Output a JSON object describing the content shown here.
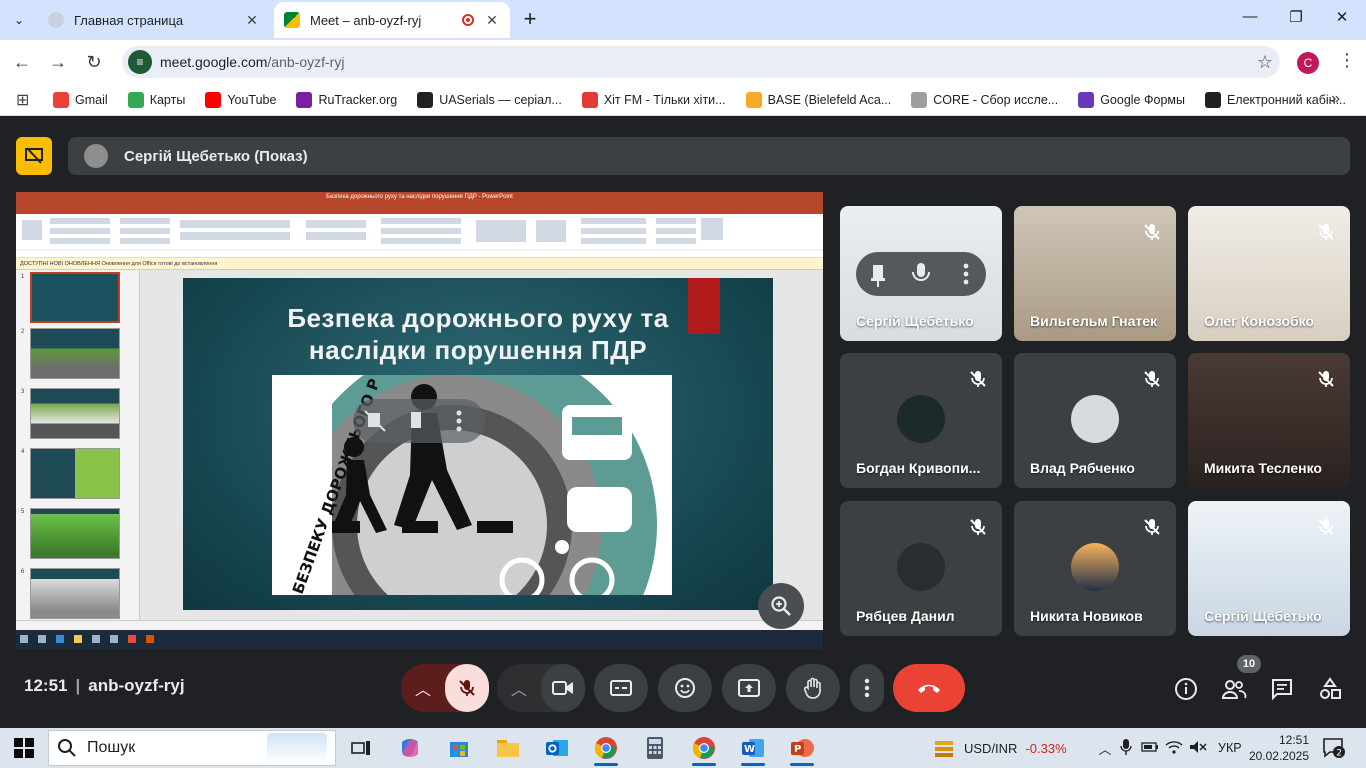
{
  "browser": {
    "tabs": [
      {
        "title": "Главная страница"
      },
      {
        "title": "Meet – anb-oyzf-ryj"
      }
    ],
    "url_host": "meet.google.com",
    "url_path": "/anb-oyzf-ryj",
    "profile_initial": "C",
    "bookmarks": [
      {
        "label": "Gmail",
        "color": "#ea4335"
      },
      {
        "label": "Карты",
        "color": "#34a853"
      },
      {
        "label": "YouTube",
        "color": "#ff0000"
      },
      {
        "label": "RuTracker.org",
        "color": "#7b1fa2"
      },
      {
        "label": "UASerials — серіал...",
        "color": "#222222"
      },
      {
        "label": "Хіт FM - Тільки хіти...",
        "color": "#e53935"
      },
      {
        "label": "BASE (Bielefeld Aca...",
        "color": "#f9a825"
      },
      {
        "label": "CORE - Сбор иссле...",
        "color": "#9e9e9e"
      },
      {
        "label": "Google Формы",
        "color": "#673ab7"
      },
      {
        "label": "Електронний кабін...",
        "color": "#1f1f1f"
      }
    ]
  },
  "meet": {
    "presenter_label": "Сергій Щебетько (Показ)",
    "meeting_time": "12:51",
    "meeting_code": "anb-oyzf-ryj",
    "participants_count": "10",
    "slide": {
      "title_line1": "Безпека дорожнього руху та",
      "title_line2": "наслідки порушення ПДР",
      "emblem_text": "БЕЗПЕКУ ДОРОЖНЬОГО Р",
      "thumb_numbers": [
        "1",
        "2",
        "3",
        "4",
        "5",
        "6"
      ]
    },
    "ppt_title": "Безпека дорожнього руху та наслідки порушення ПДР - PowerPoint",
    "ppt_infobar": "ДОСТУПНІ НОВІ ОНОВЛЕННЯ   Оновлення для Office готові до встановлення",
    "participants": [
      {
        "name": "Сергій Щебетько",
        "muted": false
      },
      {
        "name": "Вильгельм Гнатек",
        "muted": true
      },
      {
        "name": "Олег Конозобко",
        "muted": true
      },
      {
        "name": "Богдан Кривопи...",
        "muted": true
      },
      {
        "name": "Влад Рябченко",
        "muted": true
      },
      {
        "name": "Микита Тесленко",
        "muted": true
      },
      {
        "name": "Рябцев Данил",
        "muted": true
      },
      {
        "name": "Никита Новиков",
        "muted": true
      },
      {
        "name": "Сергій Щебетько",
        "muted": true
      }
    ]
  },
  "taskbar": {
    "search_label": "Пошук",
    "currency_label": "USD/INR",
    "currency_change": "-0.33%",
    "lang": "УКР",
    "time": "12:51",
    "date": "20.02.2025",
    "notifications": "2"
  },
  "colors": {
    "accent_yellow": "#fbbc04",
    "end_call_red": "#ea4335",
    "meet_bg": "#202124"
  }
}
